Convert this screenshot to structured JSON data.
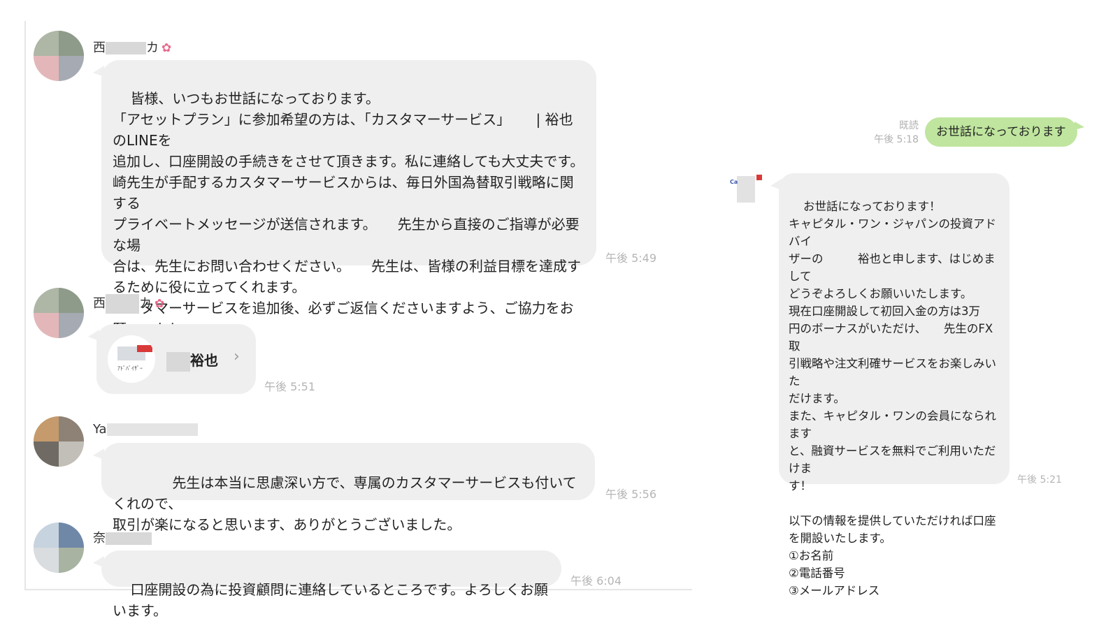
{
  "messages": [
    {
      "sender": "西",
      "sender_suffix": "カ",
      "text": "皆様、いつもお世話になっております。\n「アセットプラン」に参加希望の方は、「カスタマーサービス」　　 | 裕也のLINEを\n追加し、口座開設の手続きをさせて頂きます。私に連絡しても大丈夫です。\n崎先生が手配するカスタマーサービスからは、毎日外国為替取引戦略に関する\nプライベートメッセージが送信されます。　　先生から直接のご指導が必要な場\n合は、先生にお問い合わせください。　　先生は、皆様の利益目標を達成す\nるために役に立ってくれます。\nカスタマーサービスを追加後、必ずご返信くださいますよう、ご協力をお願いいたし\nます。",
      "time": "午後 5:49"
    },
    {
      "sender": "西",
      "sender_suffix": "カ",
      "card_name": "裕也",
      "card_chevron": "›",
      "card_logo_text": "ｱﾄﾞﾊﾞｲｻﾞｰ",
      "time": "午後 5:51"
    },
    {
      "sender": "Ya",
      "text": "　　　先生は本当に思慮深い方で、専属のカスタマーサービスも付いてくれので、\n取引が楽になると思います、ありがとうございました。",
      "time": "午後 5:56"
    },
    {
      "sender": "奈",
      "text": "口座開設の為に投資顧問に連絡しているところです。よろしくお願います。",
      "time": "午後 6:04"
    }
  ],
  "right_chat": {
    "outgoing": {
      "text": "お世話になっております",
      "read_label": "既読",
      "time": "午後 5:18"
    },
    "reply": {
      "avatar_text": "Ca",
      "text": "お世話になっております！\nキャピタル・ワン・ジャパンの投資アドバイ\nザーの　　　裕也と申します、はじめまして\nどうぞよろしくお願いいたします。\n現在口座開設して初回入金の方は3万\n円のボーナスがいただけ、　　先生のFX取\n引戦略や注文利確サービスをお楽しみいた\nだけます。\nまた、キャピタル・ワンの会員になられます\nと、融資サービスを無料でご利用いただけま\nす！\n\n以下の情報を提供していただければ口座\nを開設いたします。\n①お名前\n②電話番号\n③メールアドレス",
      "time": "午後 5:21"
    }
  },
  "colors": {
    "bubble_gray": "#efefef",
    "bubble_green": "#bfe59e",
    "timestamp": "#b5b5b5",
    "flower": "#e86a8c"
  }
}
